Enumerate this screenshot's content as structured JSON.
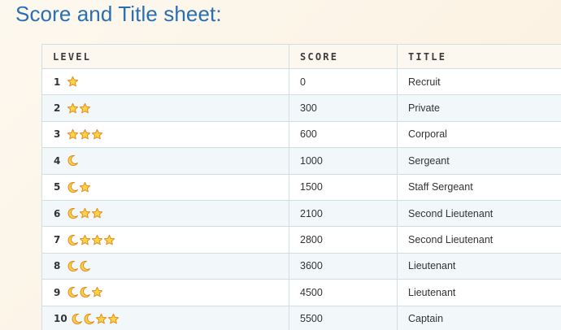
{
  "page": {
    "title": "Score and Title sheet:"
  },
  "table": {
    "headers": [
      "LEVEL",
      "SCORE",
      "TITLE"
    ],
    "rows": [
      {
        "level": "1",
        "badges": [
          "star"
        ],
        "score": "0",
        "title": "Recruit"
      },
      {
        "level": "2",
        "badges": [
          "star",
          "star"
        ],
        "score": "300",
        "title": "Private"
      },
      {
        "level": "3",
        "badges": [
          "star",
          "star",
          "star"
        ],
        "score": "600",
        "title": "Corporal"
      },
      {
        "level": "4",
        "badges": [
          "moon"
        ],
        "score": "1000",
        "title": "Sergeant"
      },
      {
        "level": "5",
        "badges": [
          "moon",
          "star"
        ],
        "score": "1500",
        "title": "Staff Sergeant"
      },
      {
        "level": "6",
        "badges": [
          "moon",
          "star",
          "star"
        ],
        "score": "2100",
        "title": "Second Lieutenant"
      },
      {
        "level": "7",
        "badges": [
          "moon",
          "star",
          "star",
          "star"
        ],
        "score": "2800",
        "title": "Second Lieutenant"
      },
      {
        "level": "8",
        "badges": [
          "moon",
          "moon"
        ],
        "score": "3600",
        "title": "Lieutenant"
      },
      {
        "level": "9",
        "badges": [
          "moon",
          "moon",
          "star"
        ],
        "score": "4500",
        "title": "Lieutenant"
      },
      {
        "level": "10",
        "badges": [
          "moon",
          "moon",
          "star",
          "star"
        ],
        "score": "5500",
        "title": "Captain"
      }
    ]
  },
  "colors": {
    "title": "#2a6fb1",
    "badge_fill": "#fbd34a",
    "badge_stroke": "#e48a1a",
    "row_alt": "#f2f8fa",
    "border": "#cfdfe4"
  },
  "icons": {
    "star": "star-icon",
    "moon": "crescent-moon-icon"
  }
}
